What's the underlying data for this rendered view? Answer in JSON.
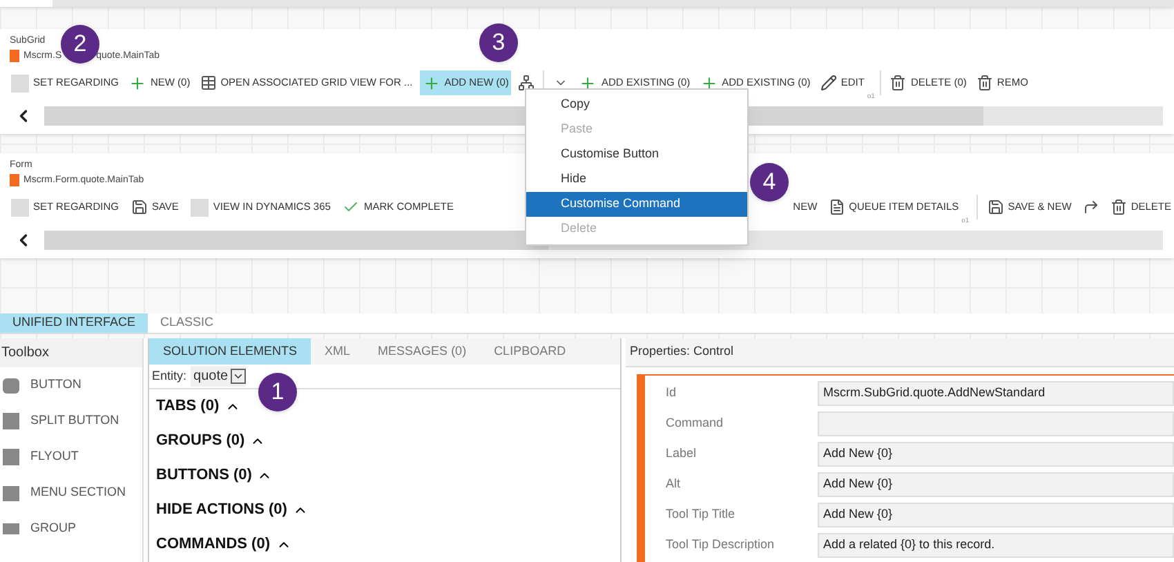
{
  "subgrid": {
    "title": "SubGrid",
    "name_start": "Mscrm.S",
    "name_end": "quote.MainTab",
    "items": [
      {
        "kind": "blank",
        "label": "SET REGARDING",
        "selected": false
      },
      {
        "kind": "plus",
        "label": "NEW (0)",
        "selected": false
      },
      {
        "kind": "grid",
        "label": "OPEN ASSOCIATED GRID VIEW FOR ...",
        "selected": false
      },
      {
        "kind": "plus",
        "label": "ADD NEW (0)",
        "selected": true
      },
      {
        "kind": "tree"
      },
      {
        "kind": "separator"
      },
      {
        "kind": "caret"
      },
      {
        "kind": "plus",
        "label": "ADD EXISTING (0)",
        "selected": false
      },
      {
        "kind": "plus",
        "label": "ADD EXISTING (0)",
        "selected": false
      },
      {
        "kind": "pencil",
        "label": "EDIT",
        "note": "o1",
        "selected": false
      },
      {
        "kind": "separator"
      },
      {
        "kind": "trash",
        "label": "DELETE (0)",
        "selected": false
      },
      {
        "kind": "trash",
        "label": "REMO",
        "selected": false
      }
    ]
  },
  "form": {
    "title": "Form",
    "name": "Mscrm.Form.quote.MainTab",
    "items": [
      {
        "kind": "blank",
        "label": "SET REGARDING",
        "selected": false
      },
      {
        "kind": "save",
        "label": "SAVE",
        "selected": false
      },
      {
        "kind": "blank",
        "label": "VIEW IN DYNAMICS 365",
        "selected": false
      },
      {
        "kind": "check",
        "label": "MARK COMPLETE",
        "selected": false
      }
    ],
    "items_after_menu": [
      {
        "kind": "text",
        "label": "NEW",
        "selected": false
      },
      {
        "kind": "doc",
        "label": "QUEUE ITEM DETAILS",
        "note": "o1",
        "selected": false
      },
      {
        "kind": "separator"
      },
      {
        "kind": "savenew",
        "label": "SAVE & NEW",
        "selected": false
      },
      {
        "kind": "arrow"
      },
      {
        "kind": "trash",
        "label": "DELETE",
        "selected": false
      }
    ]
  },
  "context_menu": [
    {
      "label": "Copy",
      "disabled": false,
      "selected": false
    },
    {
      "label": "Paste",
      "disabled": true,
      "selected": false
    },
    {
      "label": "Customise Button",
      "disabled": false,
      "selected": false
    },
    {
      "label": "Hide",
      "disabled": false,
      "selected": false
    },
    {
      "label": "Customise Command",
      "disabled": false,
      "selected": true
    },
    {
      "label": "Delete",
      "disabled": true,
      "selected": false
    }
  ],
  "callouts": [
    "2",
    "3",
    "4",
    "1"
  ],
  "mode_tabs": [
    {
      "label": "UNIFIED INTERFACE",
      "selected": true
    },
    {
      "label": "CLASSIC",
      "selected": false
    }
  ],
  "toolbox": {
    "title": "Toolbox",
    "items": [
      "BUTTON",
      "SPLIT BUTTON",
      "FLYOUT",
      "MENU SECTION",
      "GROUP"
    ]
  },
  "solution": {
    "tabs": [
      {
        "label": "SOLUTION ELEMENTS",
        "selected": true
      },
      {
        "label": "XML",
        "selected": false
      },
      {
        "label": "MESSAGES (0)",
        "selected": false
      },
      {
        "label": "CLIPBOARD",
        "selected": false
      }
    ],
    "entity_label": "Entity:",
    "entity_value": "quote",
    "sections": [
      "TABS (0)",
      "GROUPS (0)",
      "BUTTONS (0)",
      "HIDE ACTIONS (0)",
      "COMMANDS (0)"
    ]
  },
  "properties": {
    "title": "Properties: Control",
    "rows": [
      {
        "label": "Id",
        "value": "Mscrm.SubGrid.quote.AddNewStandard"
      },
      {
        "label": "Command"
      },
      {
        "label": "Label",
        "value": "Add New {0}"
      },
      {
        "label": "Alt",
        "value": "Add New {0}"
      },
      {
        "label": "Tool Tip Title",
        "value": "Add New {0}"
      },
      {
        "label": "Tool Tip Description",
        "value": "Add a related {0} to this record."
      }
    ]
  }
}
